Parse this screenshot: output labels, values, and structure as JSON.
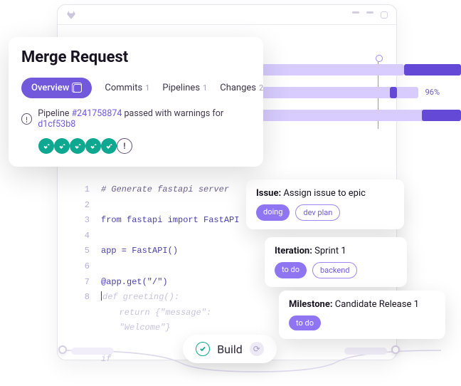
{
  "merge_request": {
    "title": "Merge Request",
    "tabs": {
      "overview": "Overview",
      "commits": {
        "label": "Commits",
        "count": "1"
      },
      "pipelines": {
        "label": "Pipelines",
        "count": "1"
      },
      "changes": {
        "label": "Changes",
        "count": "2"
      }
    },
    "pipeline": {
      "prefix": "Pipeline ",
      "id": "#241758874",
      "mid": " passed with warnings for ",
      "sha": "d1cf53b8"
    }
  },
  "roadmap": {
    "pct_label": "96%"
  },
  "code": {
    "lines": [
      {
        "n": "1",
        "text": "# Generate fastapi server",
        "cls": "tok-comment"
      },
      {
        "n": "2",
        "text": "",
        "cls": ""
      },
      {
        "n": "3",
        "text": "from fastapi import FastAPI",
        "cls": "tok-kw"
      },
      {
        "n": "4",
        "text": "",
        "cls": ""
      },
      {
        "n": "5",
        "text": "app = FastAPI()",
        "cls": "tok-op"
      },
      {
        "n": "6",
        "text": "",
        "cls": ""
      },
      {
        "n": "7",
        "text": "@app.get(\"/\")",
        "cls": "tok-fn"
      }
    ],
    "ghost_n": "8",
    "ghost1": "def greeting():",
    "ghost2": "return {\"message\": \"Welcome\"}",
    "ghost3": "if"
  },
  "cards": {
    "issue": {
      "kind": "Issue:",
      "title": "Assign issue to epic",
      "tags": [
        "doing",
        "dev plan"
      ]
    },
    "iter": {
      "kind": "Iteration:",
      "title": "Sprint 1",
      "tags": [
        "to do",
        "backend"
      ]
    },
    "mile": {
      "kind": "Milestone:",
      "title": "Candidate Release 1",
      "tags": [
        "to do"
      ]
    }
  },
  "build": {
    "label": "Build"
  }
}
